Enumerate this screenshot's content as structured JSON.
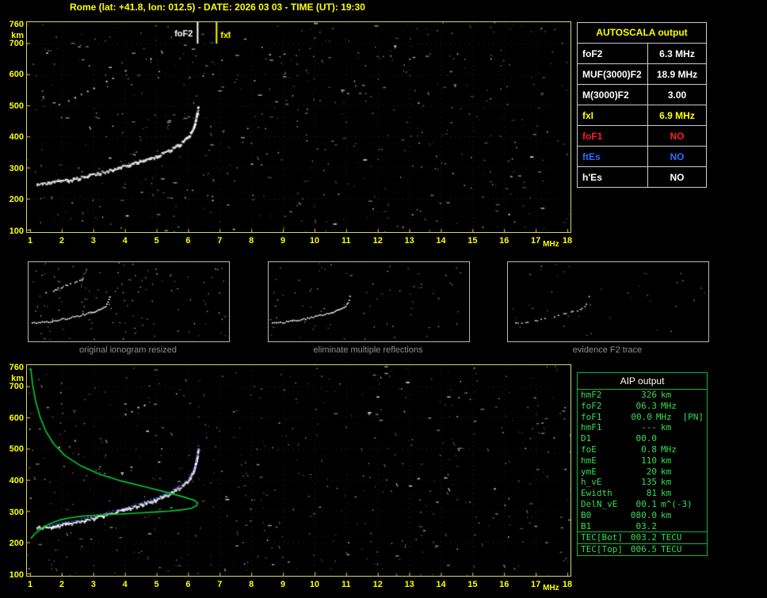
{
  "title": "Rome (lat: +41.8, lon: 012.5) - DATE: 2026 03 03 - TIME (UT): 19:30",
  "colors": {
    "background": "#000000",
    "axis_text": "#ffff00",
    "plot_border": "#d8d870",
    "grid": "rgba(185,185,110,0.22)",
    "trace_white": "#ffffff",
    "profile_green": "#00cc33",
    "restored_blue": "#3a5bff",
    "autoscala_title": "#ffff00",
    "aip_green": "#35dd55",
    "caption_gray": "#909090"
  },
  "axes": {
    "x_ticks": [
      "1",
      "2",
      "3",
      "4",
      "5",
      "6",
      "7",
      "8",
      "9",
      "10",
      "11",
      "12",
      "13",
      "14",
      "15",
      "16",
      "17",
      "18"
    ],
    "x_unit": "MHz",
    "y_ticks": [
      "760",
      "700",
      "600",
      "500",
      "400",
      "300",
      "200",
      "100"
    ],
    "y_unit": "km"
  },
  "autoscala": {
    "title": "AUTOSCALA output",
    "rows": [
      {
        "label": "foF2",
        "value": "6.3 MHz",
        "color": "#ffffff"
      },
      {
        "label": "MUF(3000)F2",
        "value": "18.9 MHz",
        "color": "#ffffff"
      },
      {
        "label": "M(3000)F2",
        "value": "3.00",
        "color": "#ffffff"
      },
      {
        "label": "fxI",
        "value": "6.9 MHz",
        "color": "#ffff00"
      },
      {
        "label": "foF1",
        "value": "NO",
        "color": "#ff2020"
      },
      {
        "label": "ftEs",
        "value": "NO",
        "color": "#2a6bff"
      },
      {
        "label": "h'Es",
        "value": "NO",
        "color": "#ffffff"
      }
    ]
  },
  "aip": {
    "title": "AIP output",
    "rows": [
      {
        "label": "hmF2",
        "value": "326",
        "unit": "km",
        "note": ""
      },
      {
        "label": "foF2",
        "value": "06.3",
        "unit": "MHz",
        "note": ""
      },
      {
        "label": "foF1",
        "value": "00.0",
        "unit": "MHz",
        "note": "[PN]"
      },
      {
        "label": "hmF1",
        "value": "---",
        "unit": "km",
        "note": ""
      },
      {
        "label": "D1",
        "value": "00.0",
        "unit": "",
        "note": ""
      },
      {
        "label": "foE",
        "value": "0.8",
        "unit": "MHz",
        "note": ""
      },
      {
        "label": "hmE",
        "value": "110",
        "unit": "km",
        "note": ""
      },
      {
        "label": "ymE",
        "value": "20",
        "unit": "km",
        "note": ""
      },
      {
        "label": "h_vE",
        "value": "135",
        "unit": "km",
        "note": ""
      },
      {
        "label": "Ewidth",
        "value": "81",
        "unit": "km",
        "note": ""
      },
      {
        "label": "DelN_vE",
        "value": "00.1",
        "unit": "m^(-3)",
        "note": ""
      },
      {
        "label": "B0",
        "value": "080.0",
        "unit": "km",
        "note": ""
      },
      {
        "label": "B1",
        "value": "03.2",
        "unit": "",
        "note": ""
      }
    ],
    "tec_rows": [
      {
        "label": "TEC[Bot]",
        "value": "003.2",
        "unit": "TECU"
      },
      {
        "label": "TEC[Top]",
        "value": "006.5",
        "unit": "TECU"
      }
    ]
  },
  "thumbnails": [
    {
      "caption": "original ionogram resized"
    },
    {
      "caption": "eliminate multiple reflections"
    },
    {
      "caption": "evidence F2 trace"
    }
  ],
  "chart_data": [
    {
      "id": "top_ionogram",
      "type": "scatter",
      "title": "",
      "xlabel": "MHz",
      "ylabel": "km",
      "xlim": [
        1,
        18
      ],
      "ylim": [
        100,
        760
      ],
      "grid": true,
      "noise_seed": 7,
      "noise_count": 560,
      "markers": [
        {
          "label": "foF2",
          "freq": 6.3,
          "color": "#ffffff"
        },
        {
          "label": "fxI",
          "freq": 6.9,
          "color": "#ffff00"
        }
      ],
      "series": [
        {
          "name": "F2 echo trace",
          "style": "echo",
          "color": "#ffffff",
          "points": [
            [
              1.2,
              250
            ],
            [
              1.6,
              252
            ],
            [
              2.0,
              258
            ],
            [
              2.5,
              268
            ],
            [
              3.0,
              280
            ],
            [
              3.5,
              293
            ],
            [
              4.0,
              308
            ],
            [
              4.5,
              323
            ],
            [
              5.0,
              340
            ],
            [
              5.4,
              358
            ],
            [
              5.7,
              376
            ],
            [
              6.0,
              402
            ],
            [
              6.15,
              430
            ],
            [
              6.22,
              455
            ],
            [
              6.27,
              480
            ],
            [
              6.3,
              505
            ]
          ]
        },
        {
          "name": "second hop trace",
          "style": "echo-sparse",
          "color": "#e8e8e8",
          "points": [
            [
              1.9,
              505
            ],
            [
              2.2,
              518
            ],
            [
              2.6,
              538
            ],
            [
              3.0,
              558
            ],
            [
              3.4,
              580
            ],
            [
              3.8,
              602
            ],
            [
              4.2,
              622
            ],
            [
              4.6,
              643
            ],
            [
              5.0,
              662
            ]
          ]
        }
      ]
    },
    {
      "id": "bottom_ionogram",
      "type": "scatter",
      "title": "",
      "xlabel": "MHz",
      "ylabel": "km",
      "xlim": [
        1,
        18
      ],
      "ylim": [
        100,
        760
      ],
      "grid": true,
      "noise_seed": 13,
      "noise_count": 520,
      "markers": [],
      "series": [
        {
          "name": "F2 echo trace",
          "style": "echo",
          "color": "#ffffff",
          "points": [
            [
              1.2,
              250
            ],
            [
              1.6,
              252
            ],
            [
              2.0,
              258
            ],
            [
              2.5,
              268
            ],
            [
              3.0,
              280
            ],
            [
              3.5,
              293
            ],
            [
              4.0,
              308
            ],
            [
              4.5,
              323
            ],
            [
              5.0,
              340
            ],
            [
              5.4,
              358
            ],
            [
              5.7,
              376
            ],
            [
              6.0,
              402
            ],
            [
              6.15,
              430
            ],
            [
              6.22,
              455
            ],
            [
              6.27,
              480
            ],
            [
              6.3,
              505
            ]
          ]
        },
        {
          "name": "second hop trace",
          "style": "echo-sparse",
          "color": "#e8e8e8",
          "points": [
            [
              1.9,
              505
            ],
            [
              2.2,
              518
            ],
            [
              2.6,
              538
            ],
            [
              3.0,
              558
            ],
            [
              3.4,
              580
            ],
            [
              3.8,
              602
            ],
            [
              4.2,
              622
            ],
            [
              4.6,
              643
            ],
            [
              5.0,
              662
            ]
          ]
        },
        {
          "name": "restored F2 trace",
          "style": "dots",
          "color": "#3a5bff",
          "points": [
            [
              1.6,
              258
            ],
            [
              2.0,
              264
            ],
            [
              2.5,
              274
            ],
            [
              3.0,
              286
            ],
            [
              3.5,
              299
            ],
            [
              4.0,
              314
            ],
            [
              4.5,
              329
            ],
            [
              5.0,
              346
            ],
            [
              5.4,
              364
            ],
            [
              5.7,
              382
            ],
            [
              6.0,
              408
            ],
            [
              6.15,
              436
            ],
            [
              6.22,
              462
            ],
            [
              6.27,
              488
            ],
            [
              6.3,
              512
            ],
            [
              6.32,
              525
            ]
          ]
        },
        {
          "name": "electron density profile",
          "style": "line",
          "color": "#00cc33",
          "points": [
            [
              1.02,
              758
            ],
            [
              1.08,
              705
            ],
            [
              1.18,
              650
            ],
            [
              1.32,
              600
            ],
            [
              1.5,
              555
            ],
            [
              1.75,
              515
            ],
            [
              2.1,
              478
            ],
            [
              2.6,
              445
            ],
            [
              3.2,
              418
            ],
            [
              3.9,
              396
            ],
            [
              4.7,
              376
            ],
            [
              5.4,
              358
            ],
            [
              5.9,
              344
            ],
            [
              6.2,
              334
            ],
            [
              6.3,
              326
            ],
            [
              6.27,
              317
            ],
            [
              6.1,
              309
            ],
            [
              5.8,
              304
            ],
            [
              5.4,
              300
            ],
            [
              5.0,
              297
            ],
            [
              4.5,
              294
            ],
            [
              4.0,
              291
            ],
            [
              3.5,
              289
            ],
            [
              3.0,
              286
            ],
            [
              2.6,
              283
            ],
            [
              2.3,
              279
            ],
            [
              2.0,
              273
            ],
            [
              1.8,
              266
            ],
            [
              1.6,
              258
            ],
            [
              1.45,
              249
            ],
            [
              1.3,
              239
            ],
            [
              1.15,
              227
            ],
            [
              1.02,
              212
            ]
          ]
        }
      ]
    }
  ]
}
